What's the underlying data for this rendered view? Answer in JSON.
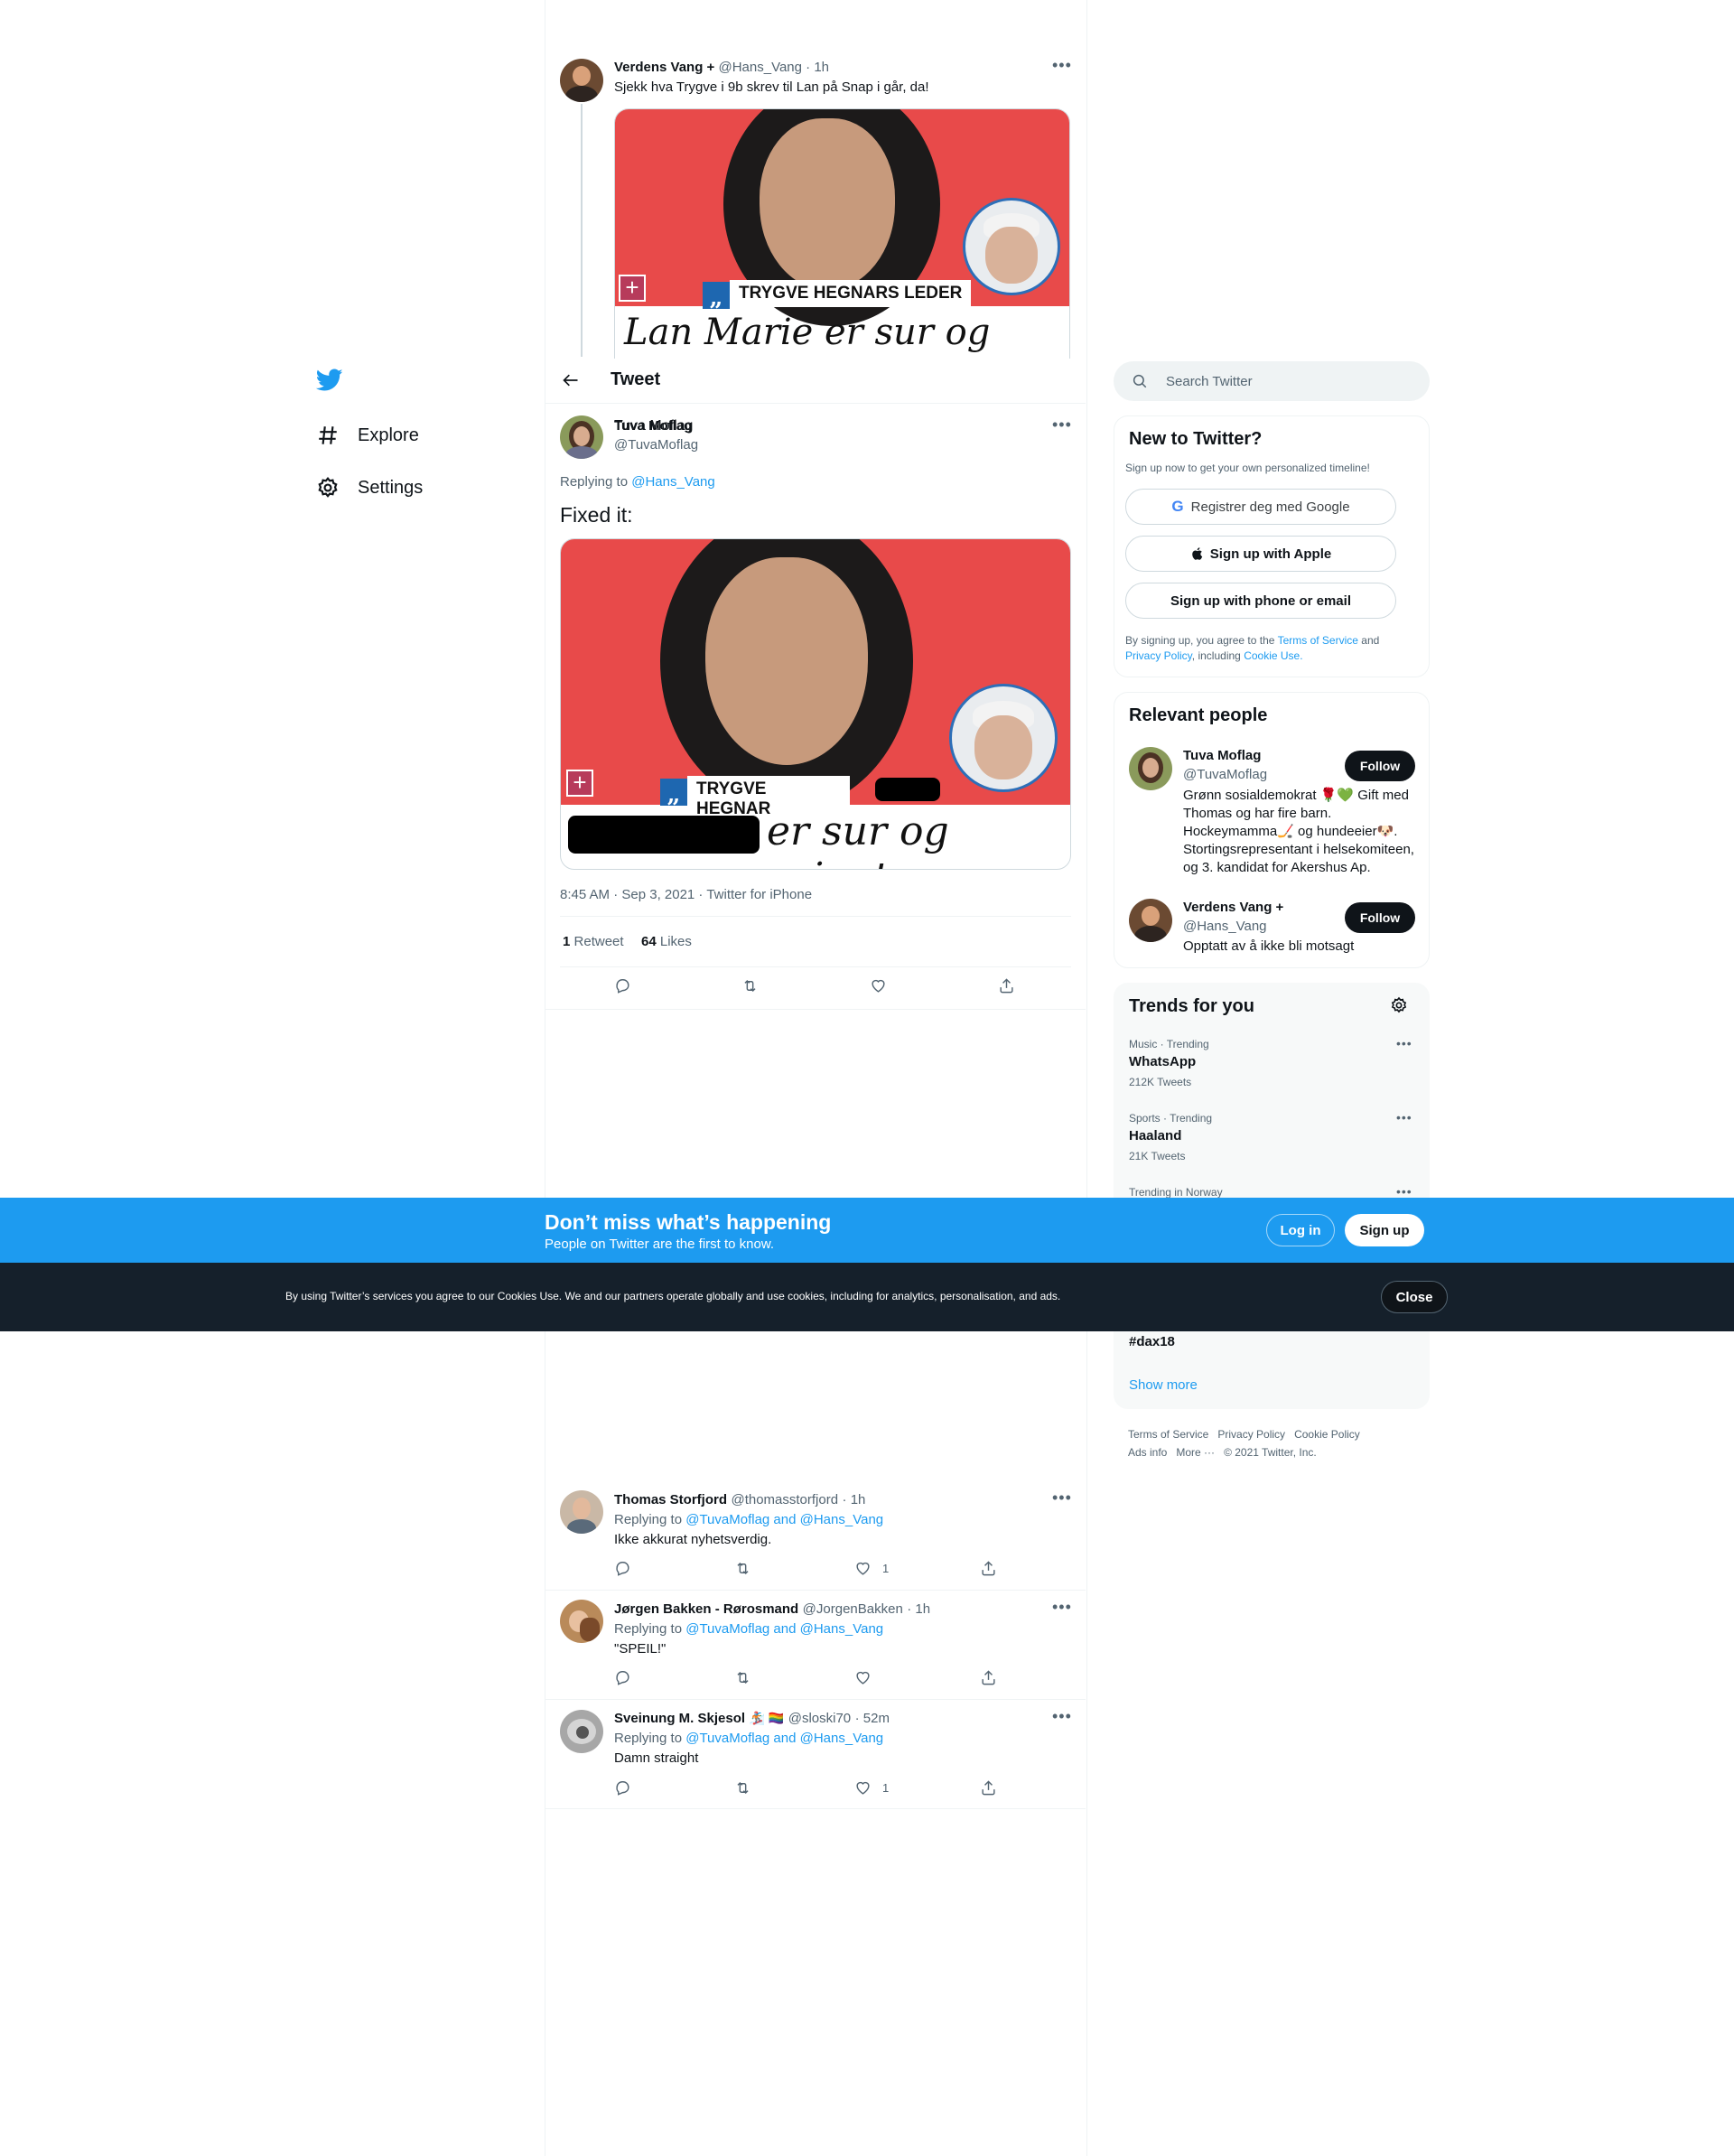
{
  "nav": {
    "explore": "Explore",
    "settings": "Settings"
  },
  "header": {
    "title": "Tweet"
  },
  "parent_tweet": {
    "name": "Verdens Vang +",
    "handle": "@Hans_Vang",
    "time": "· 1h",
    "text": "Sjekk hva Trygve i 9b skrev til Lan på Snap i går, da!",
    "image": {
      "label": "TRYGVE HEGNARS LEDER",
      "headline": "Lan Marie er sur og grinete"
    }
  },
  "main_tweet": {
    "name": "Tuva Moflag",
    "handle": "@TuvaMoflag",
    "replying_prefix": "Replying to",
    "replying_to": "@Hans_Vang",
    "text": "Fixed it:",
    "image": {
      "label": "TRYGVE HEGNAR",
      "headline": "er sur og grinete"
    },
    "meta": "8:45 AM · Sep 3, 2021 · Twitter for iPhone",
    "retweets_count": "1",
    "retweets_label": "Retweet",
    "likes_count": "64",
    "likes_label": "Likes"
  },
  "replies": [
    {
      "name": "Thomas Storfjord",
      "handle": "@thomasstorfjord",
      "time": "· 1h",
      "replying_prefix": "Replying to",
      "replying_to": "@TuvaMoflag and @Hans_Vang",
      "text": "Ikke akkurat nyhetsverdig.",
      "likes": "1"
    },
    {
      "name": "Jørgen Bakken - Rørosmand",
      "handle": "@JorgenBakken",
      "time": "· 1h",
      "replying_prefix": "Replying to",
      "replying_to": "@TuvaMoflag and @Hans_Vang",
      "text": "\"SPEIL!\"",
      "likes": ""
    },
    {
      "name": "Sveinung M. Skjesol",
      "emoji": "🏂 🏳️‍🌈",
      "handle": "@sloski70",
      "time": "· 52m",
      "replying_prefix": "Replying to",
      "replying_to": "@TuvaMoflag and @Hans_Vang",
      "text": "Damn straight",
      "likes": "1"
    }
  ],
  "search": {
    "placeholder": "Search Twitter"
  },
  "new_to_twitter": {
    "title": "New to Twitter?",
    "subtitle": "Sign up now to get your own personalized timeline!",
    "google": "Registrer deg med Google",
    "apple": "Sign up with Apple",
    "phone": "Sign up with phone or email",
    "legal_1": "By signing up, you agree to the",
    "terms": "Terms of Service",
    "legal_2": "and",
    "privacy": "Privacy Policy",
    "legal_3": ", including",
    "cookie": "Cookie Use."
  },
  "relevant_people": {
    "title": "Relevant people",
    "people": [
      {
        "name": "Tuva Moflag",
        "handle": "@TuvaMoflag",
        "follow": "Follow",
        "bio": "Grønn sosialdemokrat 🌹💚 Gift med Thomas og har fire barn. Hockeymamma🏒 og hundeeier🐶. Stortingsrepresentant i helsekomiteen, og 3. kandidat for Akershus Ap."
      },
      {
        "name": "Verdens Vang +",
        "handle": "@Hans_Vang",
        "follow": "Follow",
        "bio": "Opptatt av å ikke bli motsagt"
      }
    ]
  },
  "trends": {
    "title": "Trends for you",
    "items": [
      {
        "context": "Music · Trending",
        "name": "WhatsApp",
        "count": "212K Tweets"
      },
      {
        "context": "Sports · Trending",
        "name": "Haaland",
        "count": "21K Tweets"
      },
      {
        "context": "Trending in Norway",
        "name": "",
        "count": ""
      }
    ],
    "partial_tag": "#dax18",
    "show_more": "Show more"
  },
  "footer": {
    "terms": "Terms of Service",
    "privacy": "Privacy Policy",
    "cookie": "Cookie Policy",
    "ads": "Ads info",
    "more": "More ···",
    "copyright": "© 2021 Twitter, Inc."
  },
  "bottom_bar": {
    "title": "Don’t miss what’s happening",
    "subtitle": "People on Twitter are the first to know.",
    "login": "Log in",
    "signup": "Sign up"
  },
  "cookie_bar": {
    "text": "By using Twitter’s services you agree to our Cookies Use. We and our partners operate globally and use cookies, including for analytics, personalisation, and ads.",
    "close": "Close"
  },
  "colors": {
    "accent": "#1d9bf0",
    "dark": "#0f1419",
    "cookie_bg": "#15202b"
  }
}
